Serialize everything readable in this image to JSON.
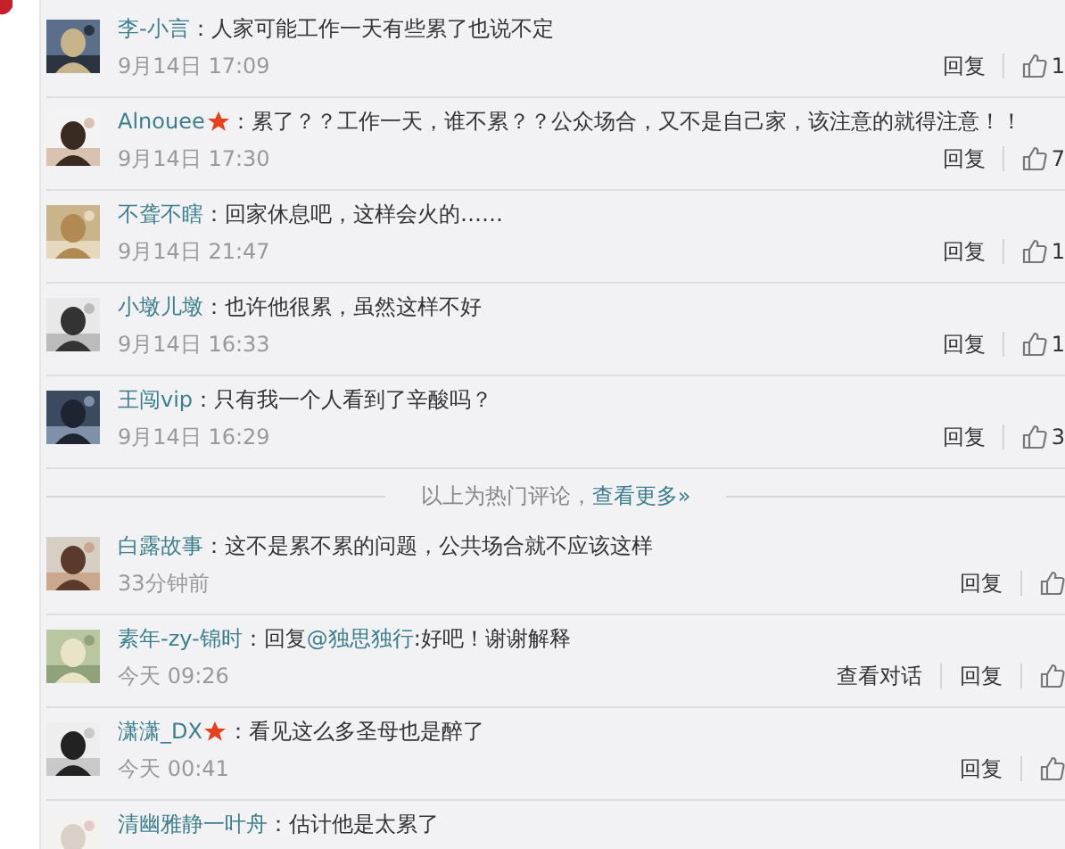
{
  "hot_comments": [
    {
      "user": "李-小言",
      "badge": false,
      "text": "：人家可能工作一天有些累了也说不定",
      "time": "9月14日 17:09",
      "actions": [
        "回复"
      ],
      "likes": "1"
    },
    {
      "user": "Alnouee",
      "badge": true,
      "text": "：累了？？工作一天，谁不累？？公众场合，又不是自己家，该注意的就得注意！！",
      "time": "9月14日 17:30",
      "actions": [
        "回复"
      ],
      "likes": "7"
    },
    {
      "user": "不聋不瞎",
      "badge": false,
      "text": "：回家休息吧，这样会火的……",
      "time": "9月14日 21:47",
      "actions": [
        "回复"
      ],
      "likes": "1"
    },
    {
      "user": "小墩儿墩",
      "badge": false,
      "text": "：也许他很累，虽然这样不好",
      "time": "9月14日 16:33",
      "actions": [
        "回复"
      ],
      "likes": "1"
    },
    {
      "user": "王闯vip",
      "badge": false,
      "text": "：只有我一个人看到了辛酸吗？",
      "time": "9月14日 16:29",
      "actions": [
        "回复"
      ],
      "likes": "3"
    }
  ],
  "hot_divider": {
    "text": "以上为热门评论，",
    "link": "查看更多»"
  },
  "comments": [
    {
      "user": "白露故事",
      "badge": false,
      "text": "：这不是累不累的问题，公共场合就不应该这样",
      "time": "33分钟前",
      "actions": [
        "回复"
      ]
    },
    {
      "user": "素年-zy-锦时",
      "badge": false,
      "text": "：回复",
      "mention": "@独思独行",
      "text_after": ":好吧！谢谢解释",
      "time": "今天 09:26",
      "actions": [
        "查看对话",
        "回复"
      ]
    },
    {
      "user": "潇潇_DX",
      "badge": true,
      "text": "：看见这么多圣母也是醉了",
      "time": "今天 00:41",
      "actions": [
        "回复"
      ]
    },
    {
      "user": "清幽雅静一叶舟",
      "badge": false,
      "text": "：估计他是太累了"
    }
  ]
}
